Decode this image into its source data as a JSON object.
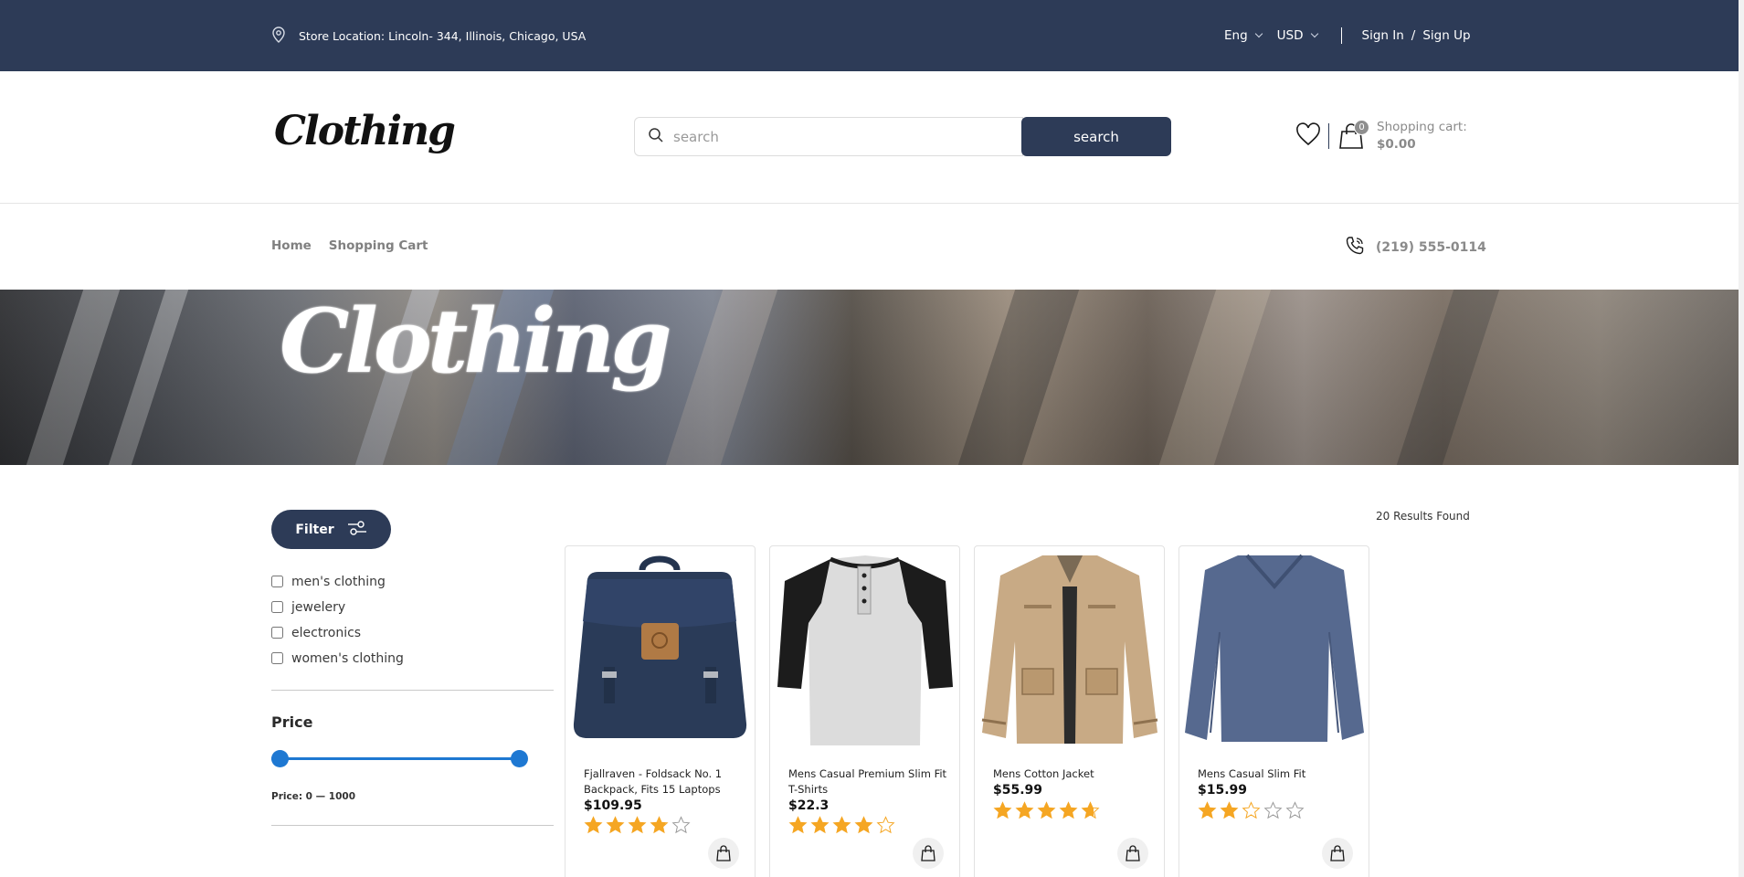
{
  "topbar": {
    "location": "Store Location: Lincoln- 344, Illinois, Chicago, USA",
    "language": "Eng",
    "currency": "USD",
    "sign_in": "Sign In",
    "separator": "/",
    "sign_up": "Sign Up"
  },
  "header": {
    "logo": "Clothing",
    "search_placeholder": "search",
    "search_button": "search",
    "cart_count": "0",
    "cart_label": "Shopping cart:",
    "cart_total": "$0.00"
  },
  "nav": {
    "links": [
      "Home",
      "Shopping Cart"
    ],
    "phone": "(219) 555-0114"
  },
  "banner": {
    "title": "Clothing"
  },
  "sidebar": {
    "filter_label": "Filter",
    "categories": [
      "men's clothing",
      "jewelery",
      "electronics",
      "women's clothing"
    ],
    "price_title": "Price",
    "price_range": "Price: 0 — 1000",
    "price_min_fraction": 0,
    "price_max_fraction": 1
  },
  "results": "20 Results Found",
  "products": [
    {
      "name": "Fjallraven - Foldsack No. 1 Backpack, Fits 15 Laptops",
      "price": "$109.95",
      "rating": 3.9,
      "image": "navy-backpack"
    },
    {
      "name": "Mens Casual Premium Slim Fit T-Shirts",
      "price": "$22.3",
      "rating": 4.1,
      "image": "raglan-henley-tshirt"
    },
    {
      "name": "Mens Cotton Jacket",
      "price": "$55.99",
      "rating": 4.7,
      "image": "khaki-cotton-jacket"
    },
    {
      "name": "Mens Casual Slim Fit",
      "price": "$15.99",
      "rating": 2.1,
      "image": "blue-long-sleeve-shirt"
    }
  ],
  "colors": {
    "navy": "#2d3b57",
    "slider_blue": "#1e78d2",
    "star_gold": "#f5a623"
  },
  "icons": [
    "location-pin-icon",
    "chevron-down-icon",
    "search-icon",
    "heart-icon",
    "shopping-bag-icon",
    "phone-icon",
    "filter-sliders-icon",
    "star-icon"
  ]
}
